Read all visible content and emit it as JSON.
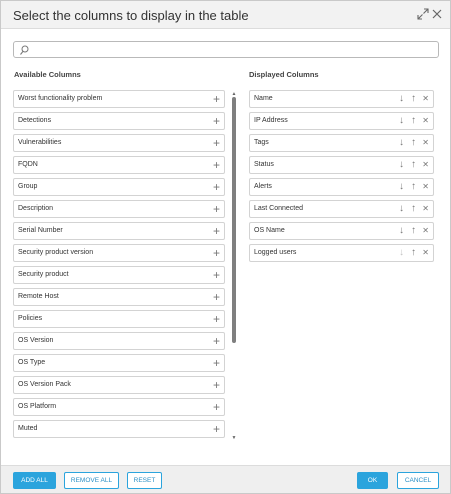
{
  "dialog": {
    "title": "Select the columns to display in the table"
  },
  "search": {
    "value": "",
    "placeholder": ""
  },
  "available": {
    "heading": "Available Columns",
    "items": [
      "Worst functionality problem",
      "Detections",
      "Vulnerabilities",
      "FQDN",
      "Group",
      "Description",
      "Serial Number",
      "Security product version",
      "Security product",
      "Remote Host",
      "Policies",
      "OS Version",
      "OS Type",
      "OS Version Pack",
      "OS Platform",
      "Muted"
    ]
  },
  "displayed": {
    "heading": "Displayed Columns",
    "items": [
      "Name",
      "IP Address",
      "Tags",
      "Status",
      "Alerts",
      "Last Connected",
      "OS Name",
      "Logged users"
    ]
  },
  "footer": {
    "add_all": "ADD ALL",
    "remove_all": "REMOVE ALL",
    "reset": "RESET",
    "ok": "OK",
    "cancel": "CANCEL"
  },
  "colors": {
    "accent": "#2ba4dd",
    "header_bg": "#f2f2f2",
    "footer_bg": "#efefef"
  },
  "icons": {
    "expand": "expand-icon",
    "close": "close-icon",
    "search": "search-icon",
    "add": "plus-icon",
    "move_down": "arrow-down-icon",
    "move_up": "arrow-up-icon",
    "remove": "remove-x-icon"
  }
}
